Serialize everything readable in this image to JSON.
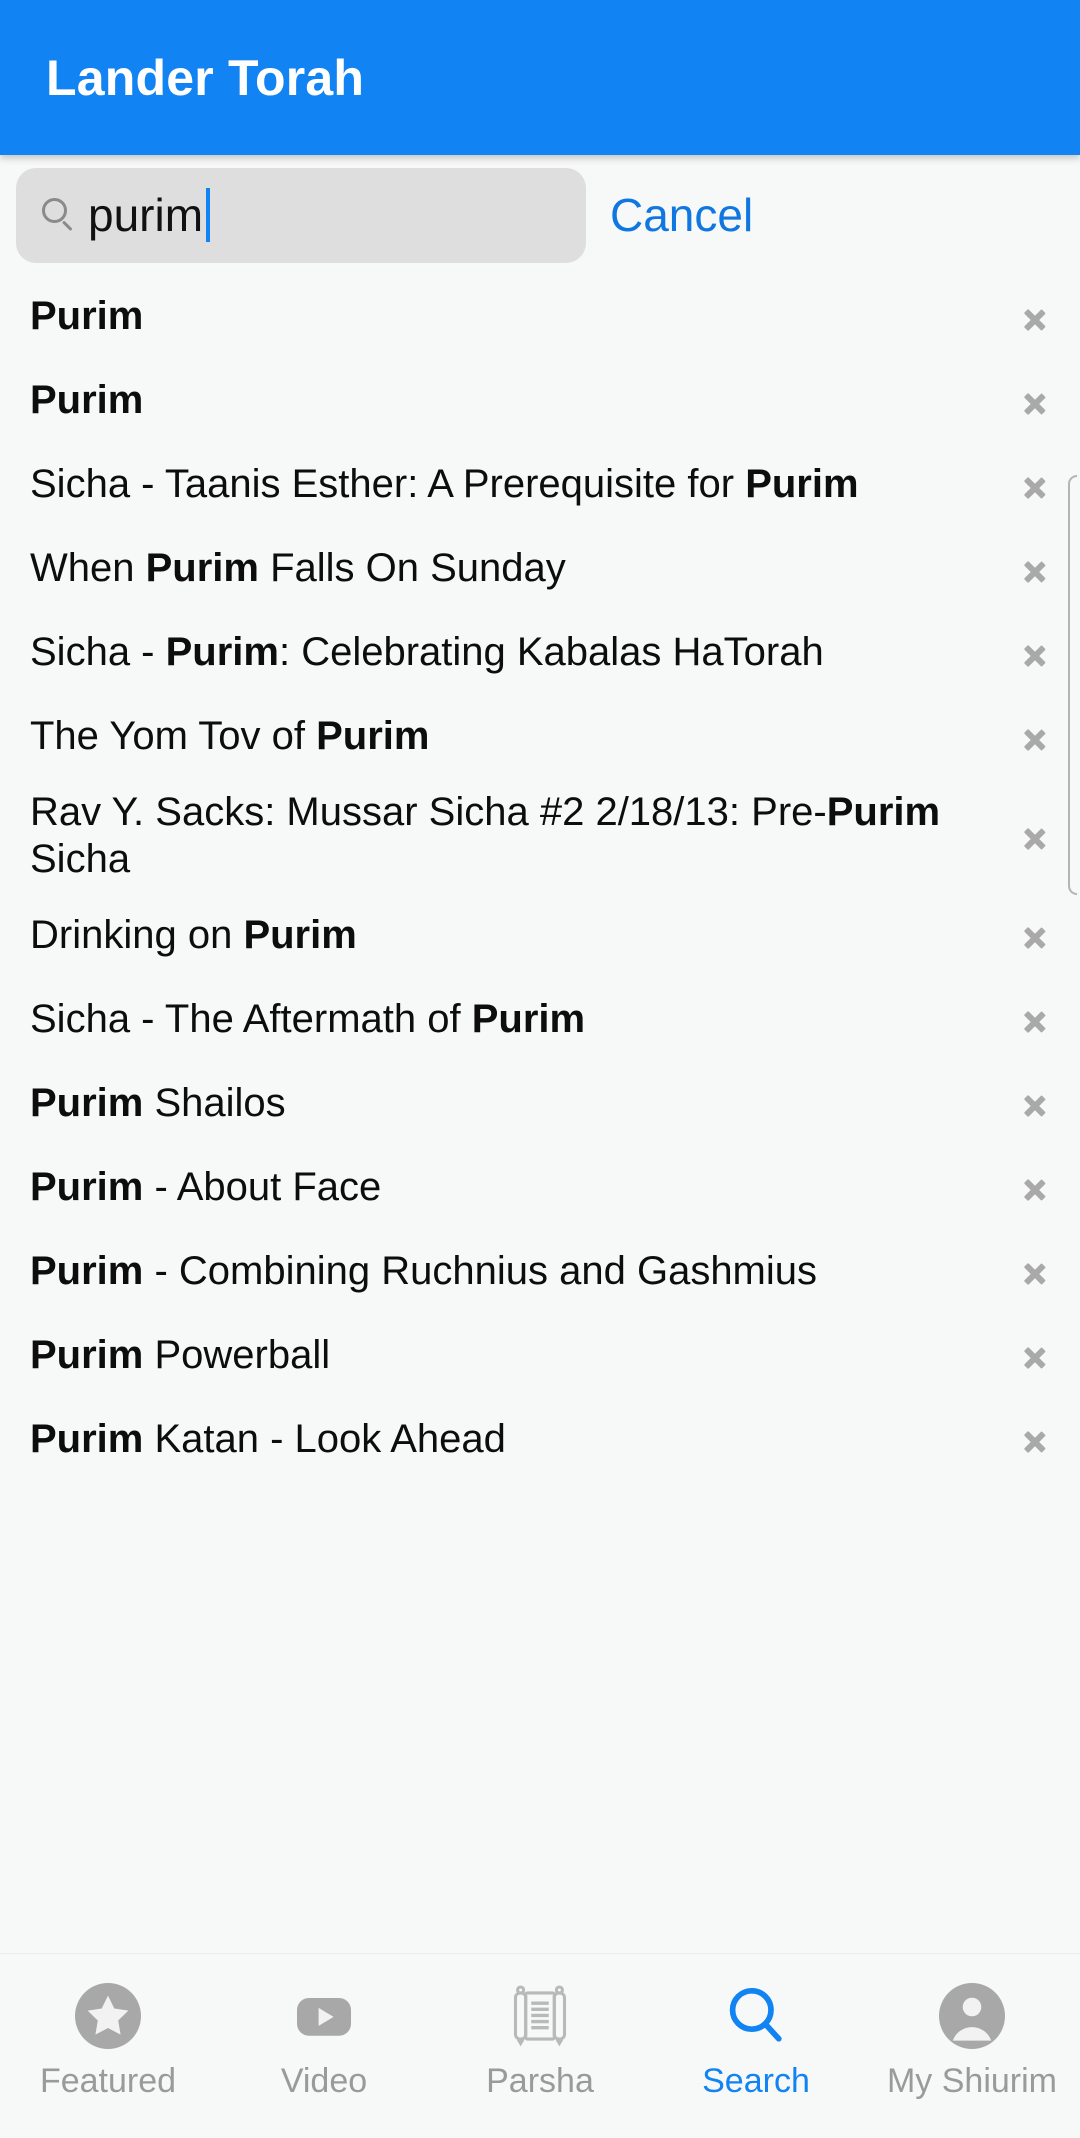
{
  "header": {
    "title": "Lander Torah",
    "bg_color": "#1283f2",
    "title_color": "#ffffff"
  },
  "search": {
    "icon": "search-icon",
    "value": "purim",
    "placeholder": "Search",
    "cancel_label": "Cancel",
    "cancel_color": "#1177e0",
    "field_bg": "#dedede",
    "caret_color": "#1283f2"
  },
  "results": {
    "highlight_term": "Purim",
    "items": [
      {
        "parts": [
          {
            "t": "Purim",
            "b": true
          }
        ]
      },
      {
        "parts": [
          {
            "t": "Purim",
            "b": true
          }
        ]
      },
      {
        "parts": [
          {
            "t": "Sicha - Taanis Esther: A Prerequisite for ",
            "b": false
          },
          {
            "t": "Purim",
            "b": true
          }
        ]
      },
      {
        "parts": [
          {
            "t": "When ",
            "b": false
          },
          {
            "t": "Purim",
            "b": true
          },
          {
            "t": " Falls On Sunday",
            "b": false
          }
        ]
      },
      {
        "parts": [
          {
            "t": "Sicha - ",
            "b": false
          },
          {
            "t": "Purim",
            "b": true
          },
          {
            "t": ": Celebrating Kabalas HaTorah",
            "b": false
          }
        ]
      },
      {
        "parts": [
          {
            "t": "The Yom Tov of ",
            "b": false
          },
          {
            "t": "Purim",
            "b": true
          }
        ]
      },
      {
        "parts": [
          {
            "t": "Rav Y. Sacks: Mussar Sicha #2 2/18/13: Pre-",
            "b": false
          },
          {
            "t": "Purim",
            "b": true
          },
          {
            "t": " Sicha",
            "b": false
          }
        ]
      },
      {
        "parts": [
          {
            "t": "Drinking on ",
            "b": false
          },
          {
            "t": "Purim",
            "b": true
          }
        ]
      },
      {
        "parts": [
          {
            "t": "Sicha - The Aftermath of ",
            "b": false
          },
          {
            "t": "Purim",
            "b": true
          }
        ]
      },
      {
        "parts": [
          {
            "t": "Purim",
            "b": true
          },
          {
            "t": " Shailos",
            "b": false
          }
        ]
      },
      {
        "parts": [
          {
            "t": "Purim",
            "b": true
          },
          {
            "t": " - About Face",
            "b": false
          }
        ]
      },
      {
        "parts": [
          {
            "t": "Purim",
            "b": true
          },
          {
            "t": " - Combining Ruchnius and Gashmius",
            "b": false
          }
        ]
      },
      {
        "parts": [
          {
            "t": "Purim",
            "b": true
          },
          {
            "t": " Powerball",
            "b": false
          }
        ]
      },
      {
        "parts": [
          {
            "t": "Purim",
            "b": true
          },
          {
            "t": " Katan - Look Ahead",
            "b": false
          }
        ]
      }
    ],
    "chevron_icon": "chevron-right-icon",
    "scrollbar_visible": true
  },
  "tabbar": {
    "active_index": 3,
    "active_color": "#1283f2",
    "inactive_color": "#9a9a9a",
    "tabs": [
      {
        "label": "Featured",
        "icon": "star-circle-icon"
      },
      {
        "label": "Video",
        "icon": "play-button-icon"
      },
      {
        "label": "Parsha",
        "icon": "torah-scroll-icon"
      },
      {
        "label": "Search",
        "icon": "search-icon"
      },
      {
        "label": "My Shiurim",
        "icon": "person-circle-icon"
      }
    ]
  }
}
